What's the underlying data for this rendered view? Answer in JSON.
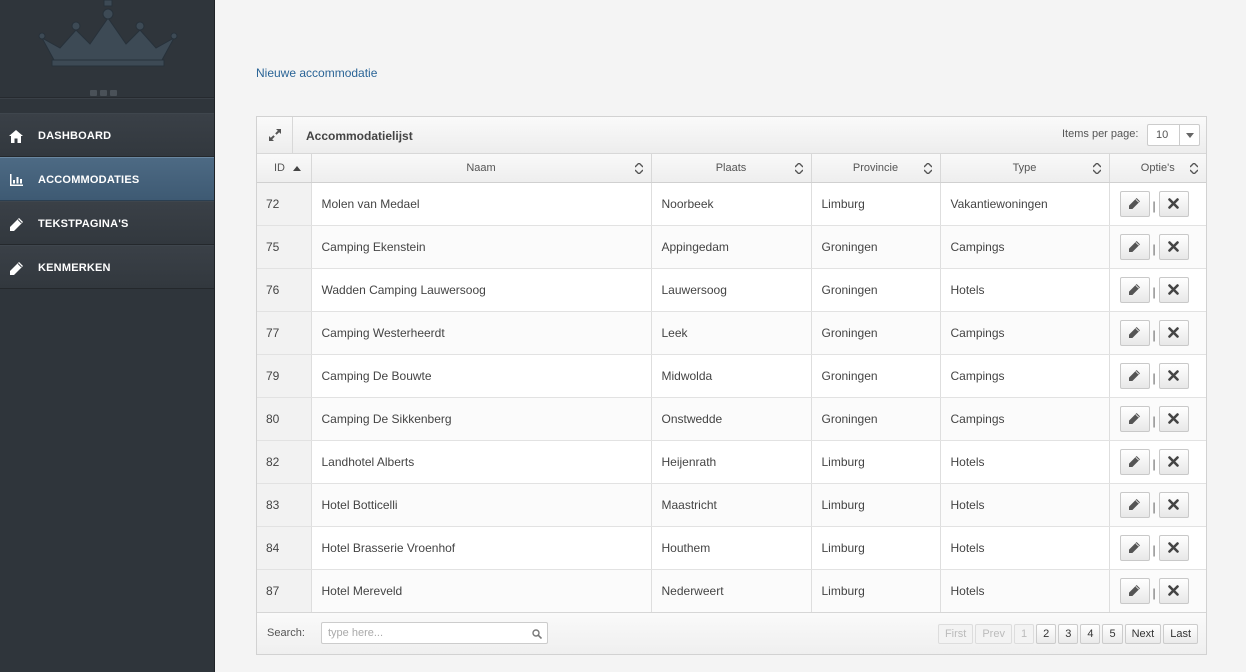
{
  "sidebar": {
    "items": [
      {
        "label": "DASHBOARD",
        "icon": "home-icon",
        "active": false
      },
      {
        "label": "ACCOMMODATIES",
        "icon": "bar-chart-icon",
        "active": true
      },
      {
        "label": "TEKSTPAGINA'S",
        "icon": "pencil-icon",
        "active": false
      },
      {
        "label": "KENMERKEN",
        "icon": "pencil-icon",
        "active": false
      }
    ]
  },
  "main": {
    "new_link": "Nieuwe accommodatie",
    "panel": {
      "title": "Accommodatielijst",
      "items_per_page_label": "Items per page:",
      "items_per_page_value": "10",
      "columns": [
        "ID",
        "Naam",
        "Plaats",
        "Provincie",
        "Type",
        "Optie's"
      ],
      "rows": [
        {
          "id": "72",
          "naam": "Molen van Medael",
          "plaats": "Noorbeek",
          "provincie": "Limburg",
          "type": "Vakantiewoningen"
        },
        {
          "id": "75",
          "naam": "Camping Ekenstein",
          "plaats": "Appingedam",
          "provincie": "Groningen",
          "type": "Campings"
        },
        {
          "id": "76",
          "naam": "Wadden Camping Lauwersoog",
          "plaats": "Lauwersoog",
          "provincie": "Groningen",
          "type": "Hotels"
        },
        {
          "id": "77",
          "naam": "Camping Westerheerdt",
          "plaats": "Leek",
          "provincie": "Groningen",
          "type": "Campings"
        },
        {
          "id": "79",
          "naam": "Camping De Bouwte",
          "plaats": "Midwolda",
          "provincie": "Groningen",
          "type": "Campings"
        },
        {
          "id": "80",
          "naam": "Camping De Sikkenberg",
          "plaats": "Onstwedde",
          "provincie": "Groningen",
          "type": "Campings"
        },
        {
          "id": "82",
          "naam": "Landhotel Alberts",
          "plaats": "Heijenrath",
          "provincie": "Limburg",
          "type": "Hotels"
        },
        {
          "id": "83",
          "naam": "Hotel Botticelli",
          "plaats": "Maastricht",
          "provincie": "Limburg",
          "type": "Hotels"
        },
        {
          "id": "84",
          "naam": "Hotel Brasserie Vroenhof",
          "plaats": "Houthem",
          "provincie": "Limburg",
          "type": "Hotels"
        },
        {
          "id": "87",
          "naam": "Hotel Mereveld",
          "plaats": "Nederweert",
          "provincie": "Limburg",
          "type": "Hotels"
        }
      ],
      "row_separator": "|",
      "search_label": "Search:",
      "search_placeholder": "type here...",
      "search_value": "",
      "pagination": {
        "first": "First",
        "prev": "Prev",
        "pages": [
          "1",
          "2",
          "3",
          "4",
          "5"
        ],
        "current": "1",
        "next": "Next",
        "last": "Last"
      }
    }
  },
  "colors": {
    "sidebar_bg": "#2f353b",
    "sidebar_active": "#4d6a84",
    "link": "#2a6496",
    "page_bg": "#f4f4f4"
  }
}
